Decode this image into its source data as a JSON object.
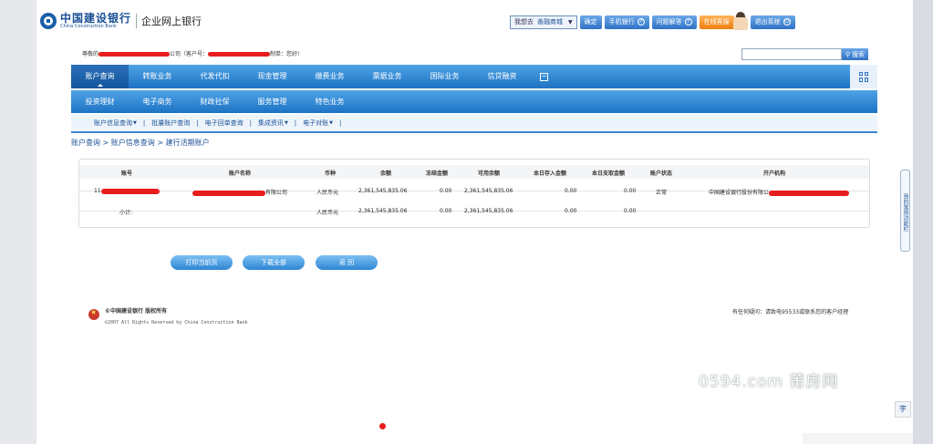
{
  "header": {
    "logo_cn": "中国建设银行",
    "logo_en": "China Construction Bank",
    "logo_sub": "企业网上银行",
    "goto_label": "我想去",
    "goto_value": "善融商城",
    "confirm": "确定",
    "mobile_bank": "手机银行",
    "faq": "问题解答",
    "online_service": "在线客服",
    "logout": "退出系统"
  },
  "welcome": {
    "prefix": "尊敬的",
    "mid": "公司（客户号：",
    "suffix": "制单：您好!"
  },
  "search": {
    "button": "搜索",
    "placeholder": ""
  },
  "nav": {
    "row1": [
      "账户查询",
      "转账业务",
      "代发代扣",
      "现金管理",
      "缴费业务",
      "票据业务",
      "国际业务",
      "信贷融资"
    ],
    "row2": [
      "投资理财",
      "电子商务",
      "财政社保",
      "服务管理",
      "特色业务"
    ],
    "minus": "−"
  },
  "subnav": [
    "账户信息查询",
    "批量账户查询",
    "电子回单查询",
    "集成资讯",
    "电子对账"
  ],
  "breadcrumb": "账户查询 > 账户信息查询 > 建行活期账户",
  "table": {
    "headers": [
      "账号",
      "账户名称",
      "币种",
      "余额",
      "冻结金额",
      "可用余额",
      "本日存入金额",
      "本日支取金额",
      "账户状态",
      "开户机构"
    ],
    "row": {
      "account_prefix": "11",
      "name_suffix": "有限公司",
      "currency": "人民币元",
      "balance": "2,361,545,835.06",
      "frozen": "0.00",
      "available": "2,361,545,835.06",
      "deposit_today": "0.00",
      "withdraw_today": "0.00",
      "status": "正常",
      "branch": "中国建设银行股份有限公"
    },
    "subtotal": {
      "label": "小计:",
      "currency": "人民币元",
      "balance": "2,361,545,835.06",
      "frozen": "0.00",
      "available": "2,361,545,835.06",
      "deposit_today": "0.00",
      "withdraw_today": "0.00"
    }
  },
  "buttons": {
    "print": "打印当前页",
    "download": "下载全部",
    "back": "返  回"
  },
  "footer": {
    "copyright_cn": "©中国建设银行 版权所有",
    "copyright_en": "©2007 All Rights Reserved by China Construction Bank",
    "hotline": "有任何疑问：请致电95533或联系您的客户经理"
  },
  "side_tab": "我的常用功能栏",
  "side_char": "字",
  "watermark": "0594.com 莆房网",
  "colors": {
    "nav_blue": "#1d73c4",
    "accent_orange": "#f07d10",
    "redaction": "#e81d1d"
  }
}
